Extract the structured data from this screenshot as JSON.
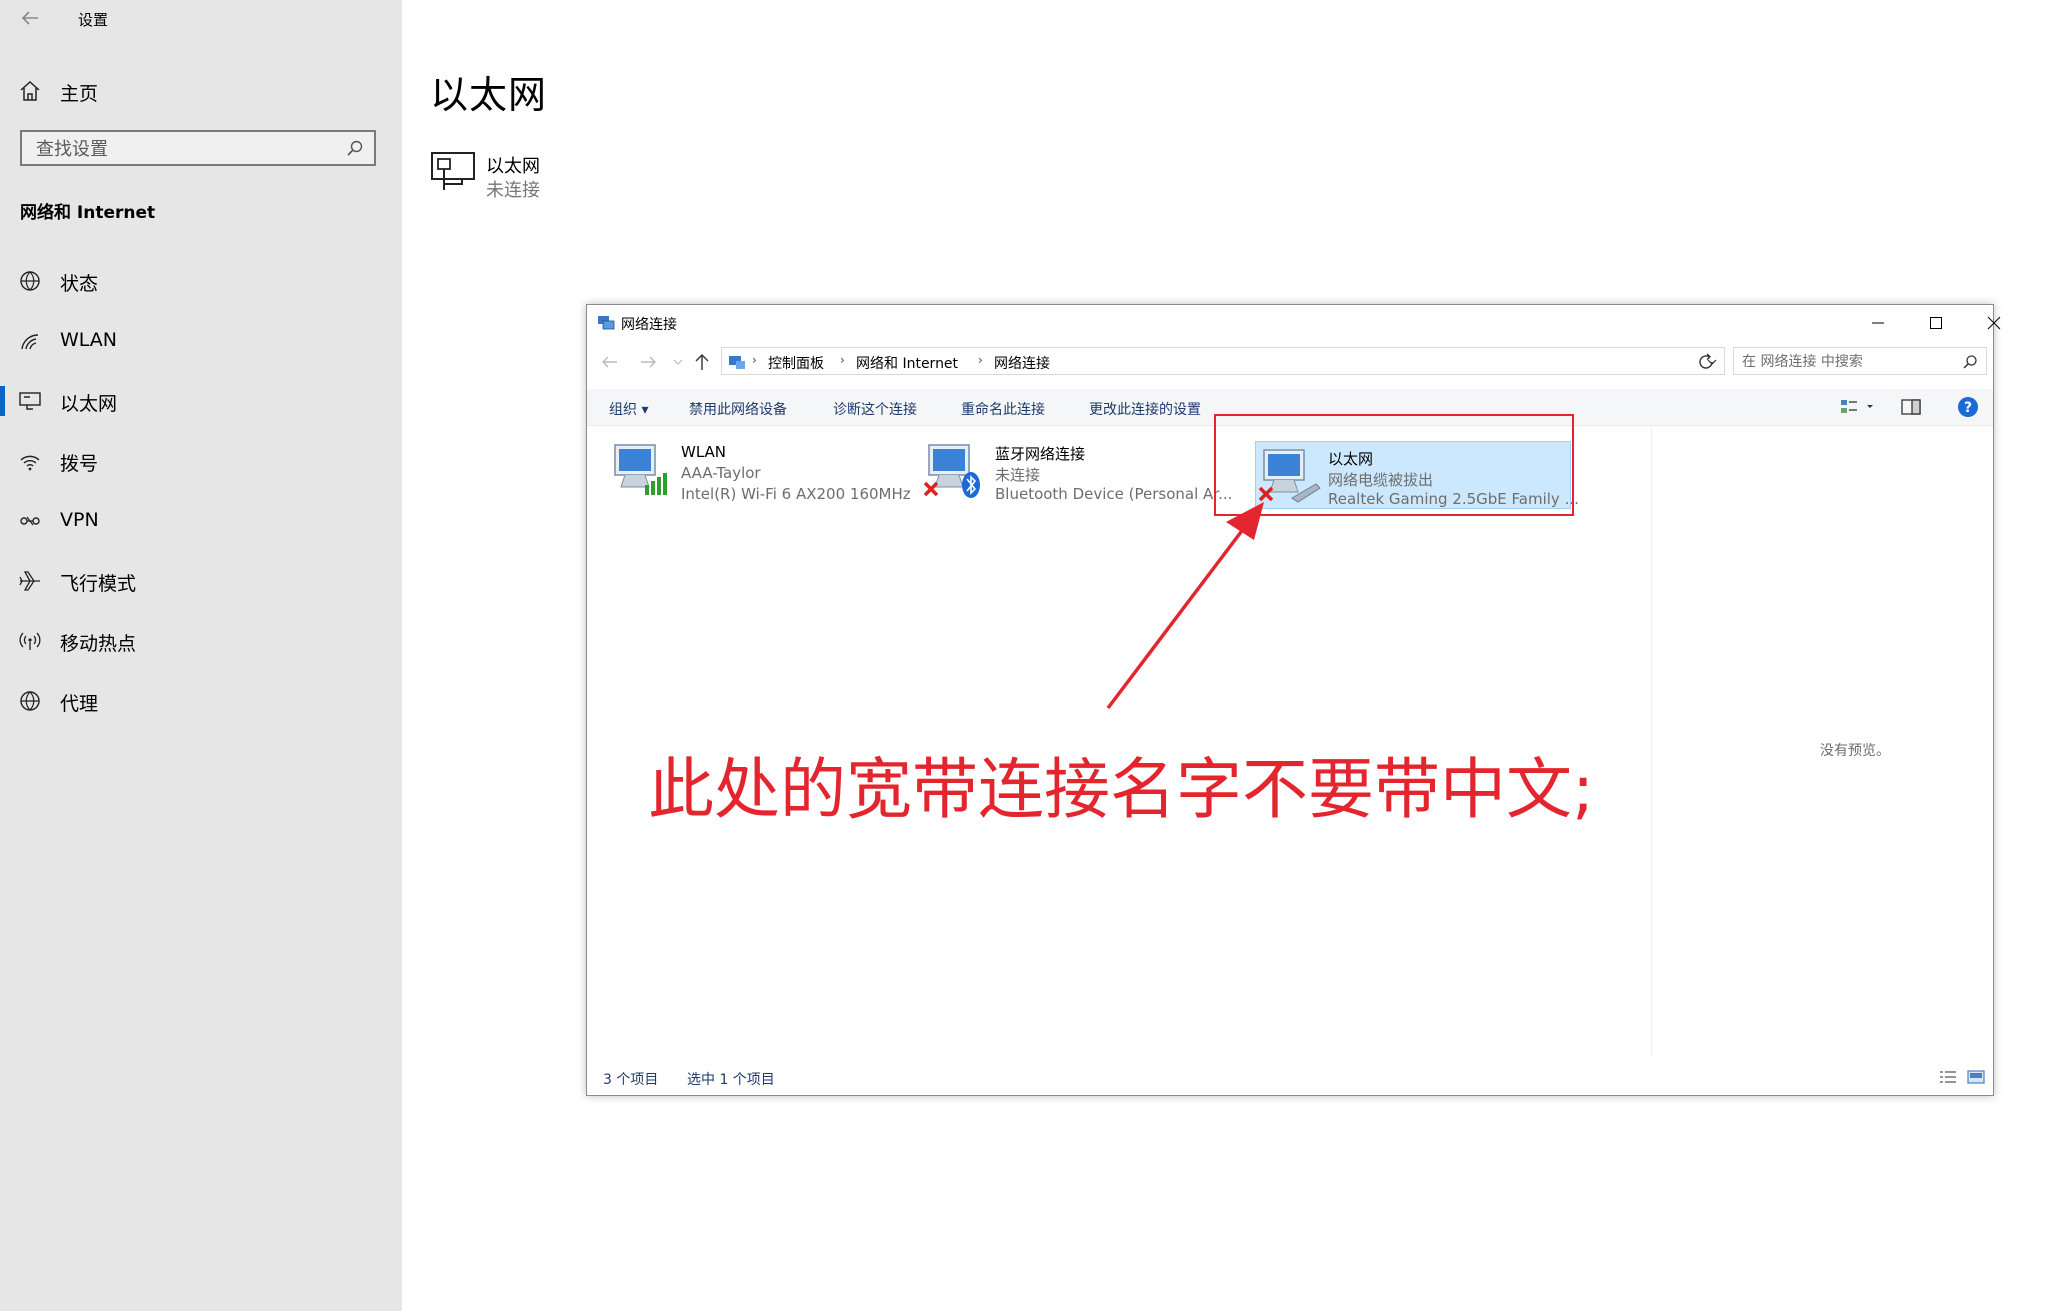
{
  "settings": {
    "title": "设置",
    "home": "主页",
    "search_placeholder": "查找设置",
    "section": "网络和 Internet",
    "nav": [
      {
        "label": "状态",
        "icon": "globe-status-icon"
      },
      {
        "label": "WLAN",
        "icon": "wifi-icon"
      },
      {
        "label": "以太网",
        "icon": "ethernet-icon",
        "active": true
      },
      {
        "label": "拨号",
        "icon": "dialup-icon"
      },
      {
        "label": "VPN",
        "icon": "vpn-icon"
      },
      {
        "label": "飞行模式",
        "icon": "airplane-icon"
      },
      {
        "label": "移动热点",
        "icon": "hotspot-icon"
      },
      {
        "label": "代理",
        "icon": "globe-proxy-icon"
      }
    ],
    "page_title": "以太网",
    "ethernet": {
      "name": "以太网",
      "status": "未连接"
    }
  },
  "explorer": {
    "title": "网络连接",
    "breadcrumb": [
      "控制面板",
      "网络和 Internet",
      "网络连接"
    ],
    "search_placeholder": "在 网络连接 中搜索",
    "commands": [
      "组织 ▾",
      "禁用此网络设备",
      "诊断这个连接",
      "重命名此连接",
      "更改此连接的设置"
    ],
    "connections": [
      {
        "name": "WLAN",
        "line2": "AAA-Taylor",
        "line3": "Intel(R) Wi-Fi 6 AX200 160MHz",
        "selected": false
      },
      {
        "name": "蓝牙网络连接",
        "line2": "未连接",
        "line3": "Bluetooth Device (Personal Ar...",
        "selected": false
      },
      {
        "name": "以太网",
        "line2": "网络电缆被拔出",
        "line3": "Realtek Gaming 2.5GbE Family ...",
        "selected": true
      }
    ],
    "preview_text": "没有预览。",
    "status_count": "3 个项目",
    "status_selected": "选中 1 个项目"
  },
  "annotation": {
    "text": "此处的宽带连接名字不要带中文;",
    "color": "#e3262d"
  },
  "colors": {
    "accent": "#0a64c8",
    "selection_bg": "#cce8ff",
    "annotation": "#e3262d"
  }
}
